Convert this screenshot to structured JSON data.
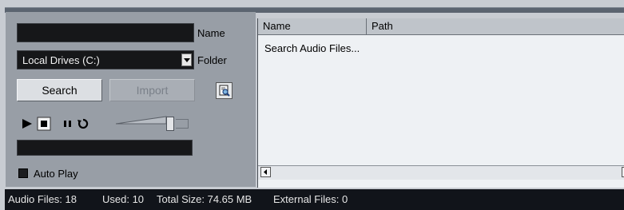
{
  "search": {
    "name_label": "Name",
    "name_value": "",
    "folder_label": "Folder",
    "folder_selected": "Local Drives (C:)",
    "search_button": "Search",
    "import_button": "Import",
    "auto_play_label": "Auto Play",
    "auto_play_checked": false
  },
  "transport": {
    "icons": [
      "play-icon",
      "stop-icon",
      "pause-icon",
      "loop-icon"
    ]
  },
  "results": {
    "columns": [
      "Name",
      "Path"
    ],
    "rows": [
      "Search Audio Files..."
    ]
  },
  "status": {
    "audio_files": "Audio Files: 18",
    "used": "Used: 10",
    "total_size": "Total Size: 74.65 MB",
    "external_files": "External Files: 0"
  },
  "colors": {
    "panel": "#989ea6",
    "field": "#161719",
    "statusbar": "#11141a",
    "list_background": "#eef1f4"
  }
}
